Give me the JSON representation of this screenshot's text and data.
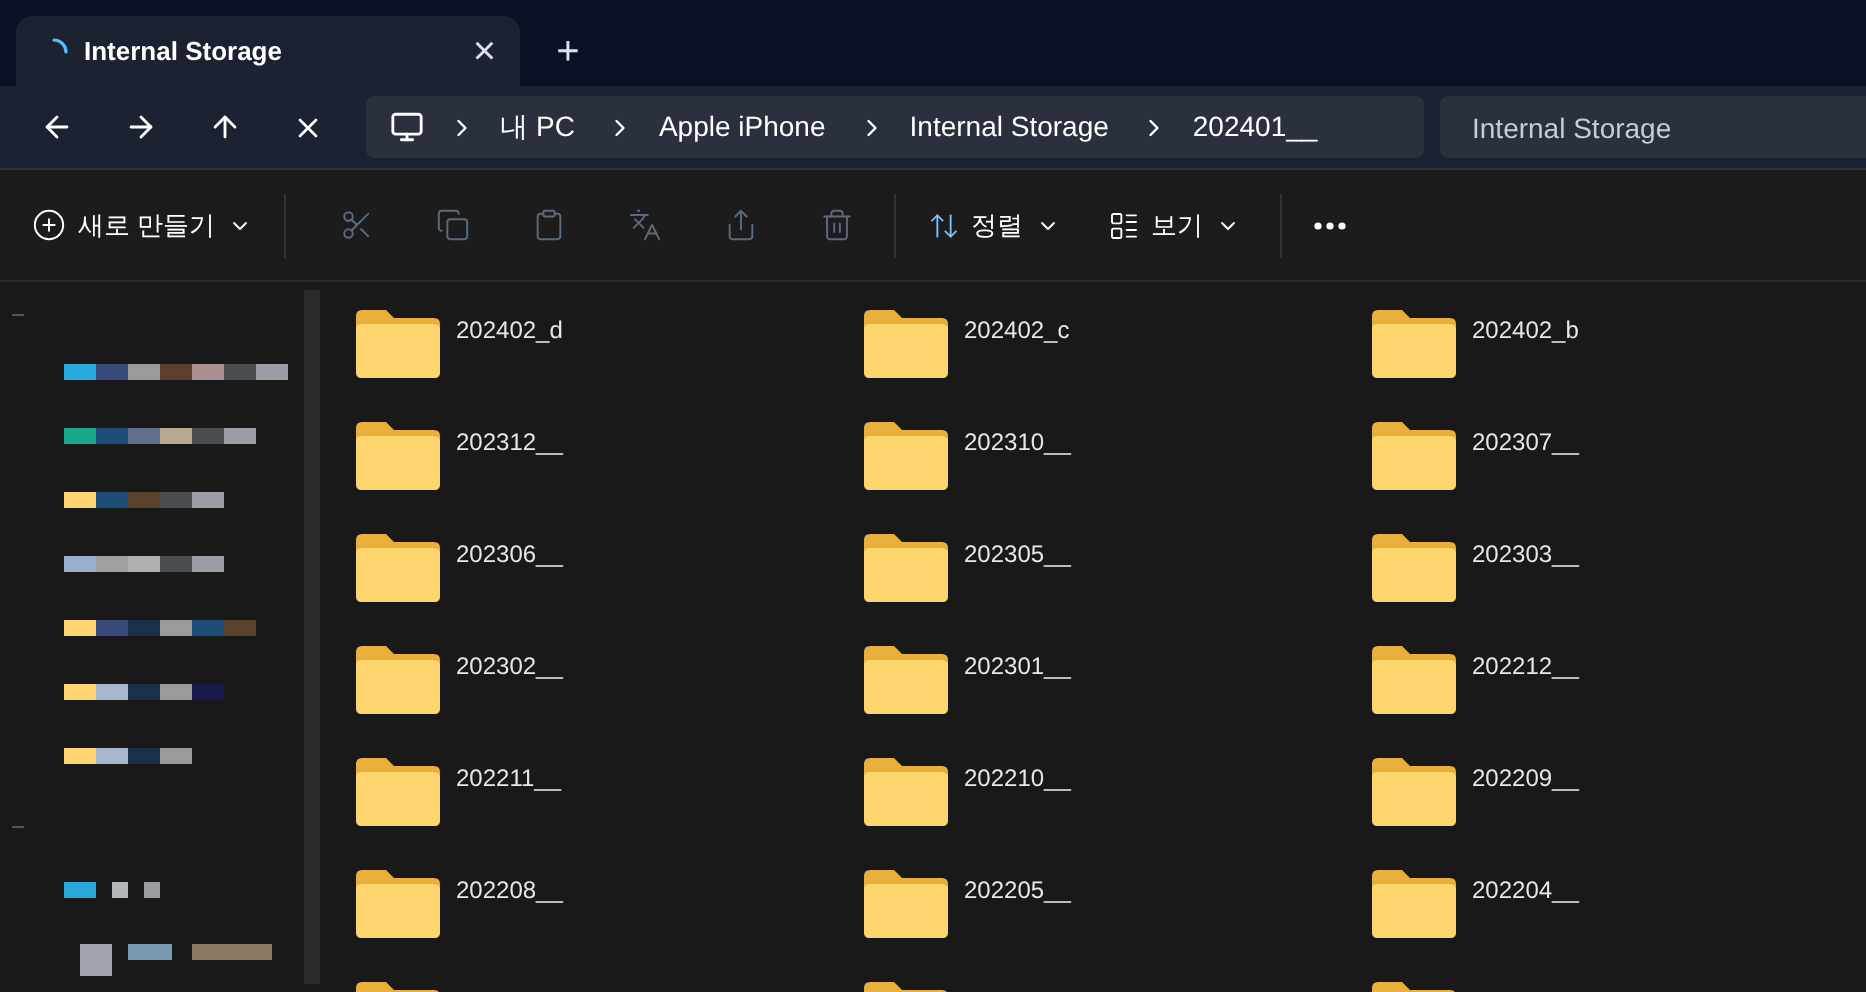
{
  "tab": {
    "title": "Internal Storage",
    "close": "×",
    "new_tab": "+"
  },
  "breadcrumbs": [
    "내 PC",
    "Apple iPhone",
    "Internal Storage",
    "202401__"
  ],
  "search": {
    "placeholder": "Internal Storage"
  },
  "toolbar": {
    "new_label": "새로 만들기",
    "sort_label": "정렬",
    "view_label": "보기"
  },
  "folders": [
    {
      "name": "202402_d"
    },
    {
      "name": "202402_c"
    },
    {
      "name": "202402_b"
    },
    {
      "name": "202312__"
    },
    {
      "name": "202310__"
    },
    {
      "name": "202307__"
    },
    {
      "name": "202306__"
    },
    {
      "name": "202305__"
    },
    {
      "name": "202303__"
    },
    {
      "name": "202302__"
    },
    {
      "name": "202301__"
    },
    {
      "name": "202212__"
    },
    {
      "name": "202211__"
    },
    {
      "name": "202210__"
    },
    {
      "name": "202209__"
    },
    {
      "name": "202208__"
    },
    {
      "name": "202205__"
    },
    {
      "name": "202204__"
    }
  ]
}
